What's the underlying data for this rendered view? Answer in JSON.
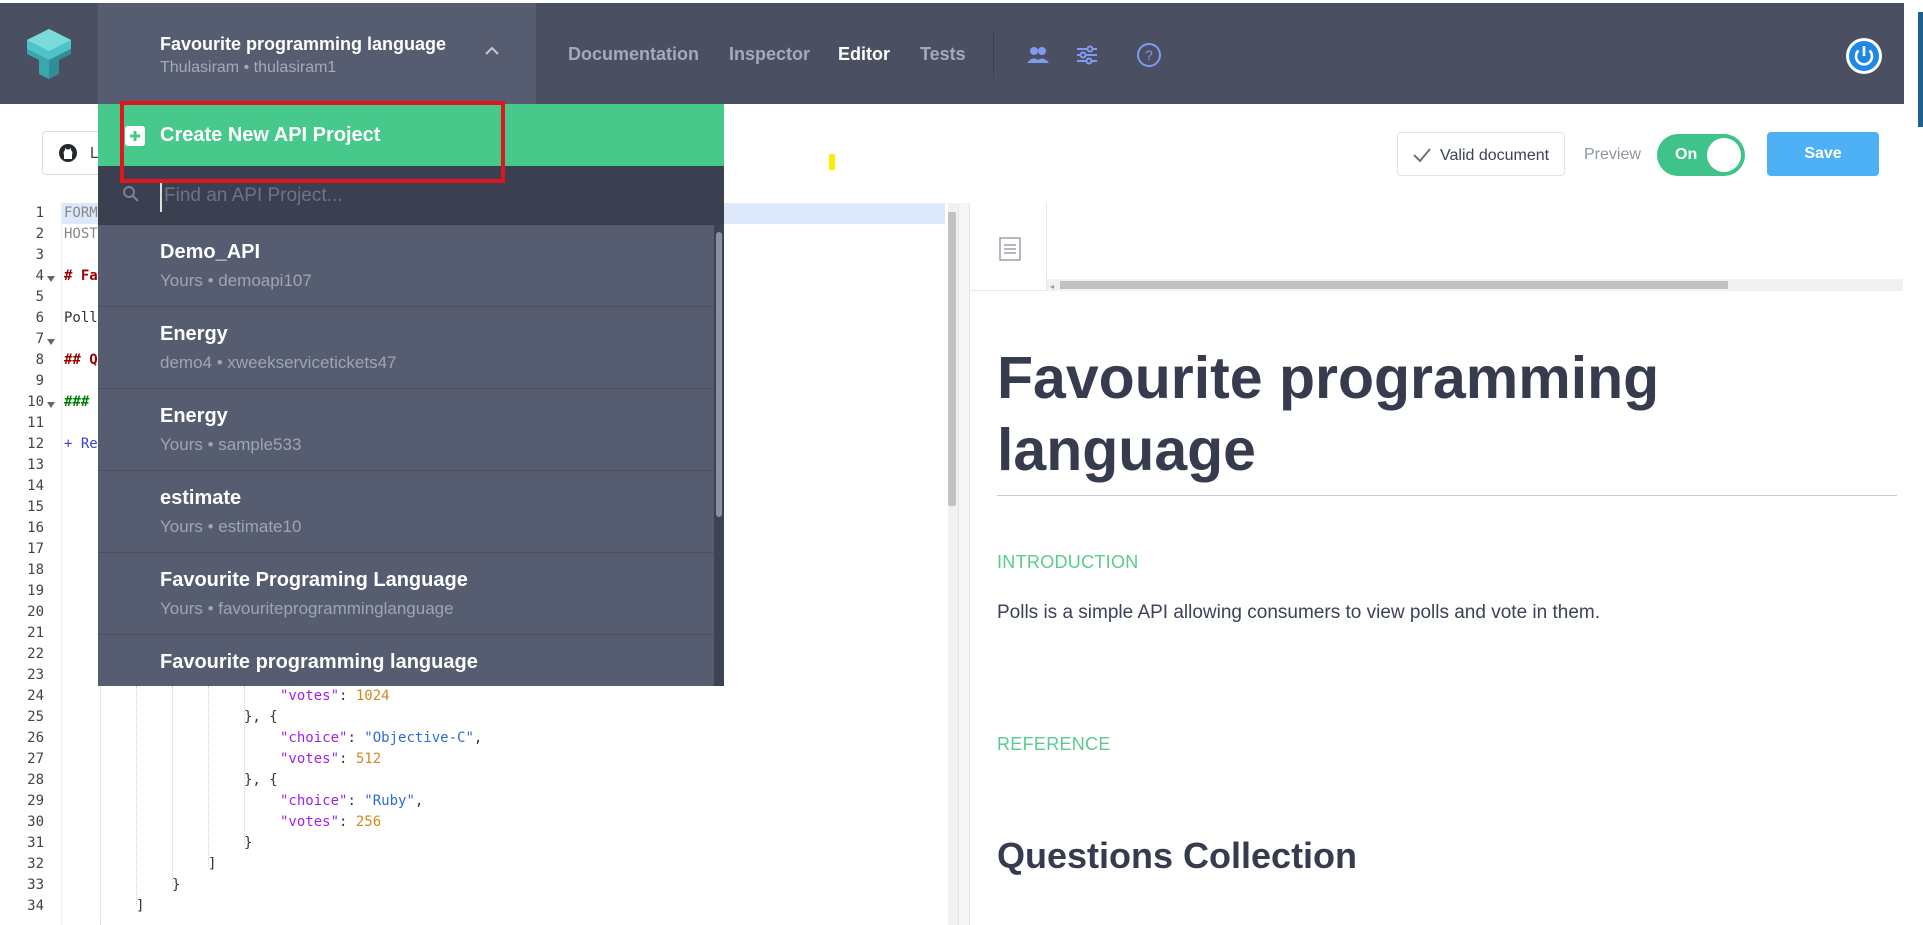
{
  "app": {
    "project_title": "Favourite programming language",
    "project_sub": "Thulasiram • thulasiram1",
    "nav": [
      "Documentation",
      "Inspector",
      "Editor",
      "Tests"
    ],
    "active_nav": "Editor"
  },
  "toolbar": {
    "github_label": "L",
    "valid_label": "Valid document",
    "preview_label": "Preview",
    "toggle_label": "On",
    "save_label": "Save"
  },
  "dropdown": {
    "create_label": "Create New API Project",
    "search_placeholder": "Find an API Project...",
    "items": [
      {
        "title": "Demo_API",
        "sub": "Yours • demoapi107"
      },
      {
        "title": "Energy",
        "sub": "demo4 • xweekservicetickets47"
      },
      {
        "title": "Energy",
        "sub": "Yours • sample533"
      },
      {
        "title": "estimate",
        "sub": "Yours • estimate10"
      },
      {
        "title": "Favourite Programing Language",
        "sub": "Yours • favouriteprogramminglanguage"
      },
      {
        "title": "Favourite programming language",
        "sub": ""
      }
    ]
  },
  "editor": {
    "line_numbers": [
      "1",
      "2",
      "3",
      "4",
      "5",
      "6",
      "7",
      "8",
      "9",
      "10",
      "11",
      "12",
      "13",
      "14",
      "15",
      "16",
      "17",
      "18",
      "19",
      "20",
      "21",
      "22",
      "23",
      "24",
      "25",
      "26",
      "27",
      "28",
      "29",
      "30",
      "31",
      "32",
      "33",
      "34"
    ],
    "visible_fragments": {
      "l1": "FORM",
      "l2": "HOST",
      "l4": "# Fa",
      "l6": "Poll",
      "l8": "## Q",
      "l10": "###",
      "l12": "+ Re"
    },
    "code": {
      "l24_key": "\"votes\"",
      "l24_val": "1024",
      "l25": "}, {",
      "l26_key": "\"choice\"",
      "l26_val": "\"Objective-C\"",
      "l27_key": "\"votes\"",
      "l27_val": "512",
      "l28": "}, {",
      "l29_key": "\"choice\"",
      "l29_val": "\"Ruby\"",
      "l30_key": "\"votes\"",
      "l30_val": "256",
      "l31": "}",
      "l32": "]",
      "l33": "}",
      "l34": "]"
    }
  },
  "preview": {
    "title": "Favourite programming language",
    "intro_label": "INTRODUCTION",
    "intro_text": "Polls is a simple API allowing consumers to view polls and vote in them.",
    "reference_label": "REFERENCE",
    "section_h2": "Questions Collection"
  },
  "colors": {
    "topbar": "#4a5062",
    "accent_green": "#48c98c",
    "save_blue": "#4eb1f5",
    "highlight_red": "#e0161e"
  }
}
